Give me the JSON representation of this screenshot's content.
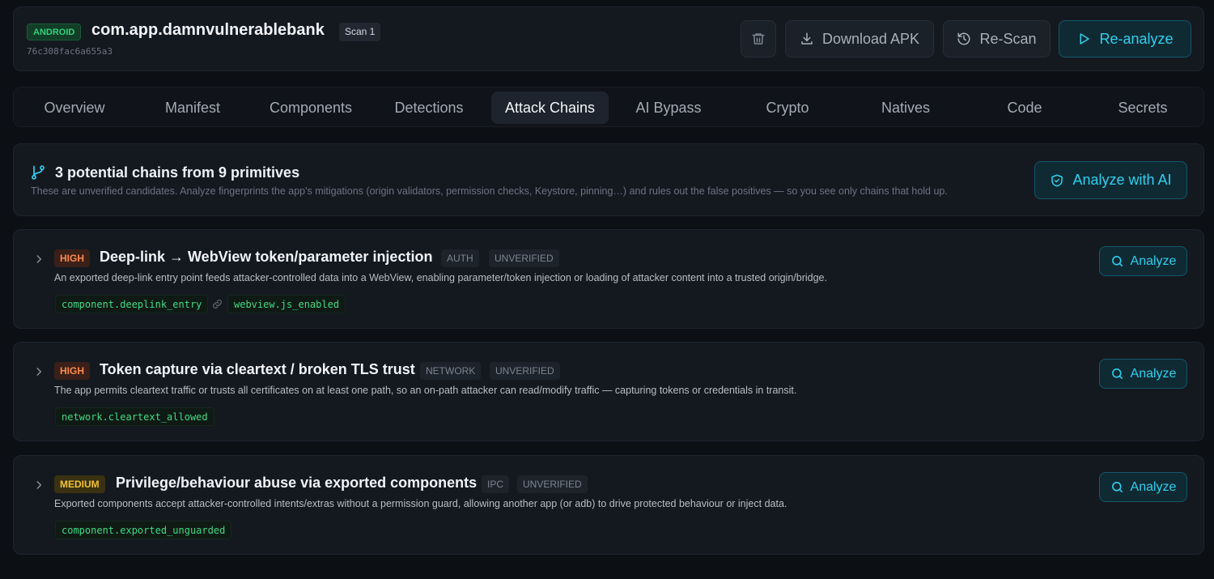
{
  "header": {
    "platform": "ANDROID",
    "package": "com.app.damnvulnerablebank",
    "scan": "Scan 1",
    "hash": "76c308fac6a655a3",
    "download_label": "Download APK",
    "rescan_label": "Re-Scan",
    "reanalyze_label": "Re-analyze",
    "delete_icon": "trash-icon"
  },
  "tabs": [
    "Overview",
    "Manifest",
    "Components",
    "Detections",
    "Attack Chains",
    "AI Bypass",
    "Crypto",
    "Natives",
    "Code",
    "Secrets"
  ],
  "active_tab": "Attack Chains",
  "summary": {
    "title": "3 potential chains from 9 primitives",
    "description": "These are unverified candidates. Analyze fingerprints the app's mitigations (origin validators, permission checks, Keystore, pinning…) and rules out the false positives — so you see only chains that hold up.",
    "analyze_ai_label": "Analyze with AI"
  },
  "chains": [
    {
      "severity": "HIGH",
      "title": "Deep-link → WebView token/parameter injection",
      "category": "AUTH",
      "status": "UNVERIFIED",
      "description": "An exported deep-link entry point feeds attacker-controlled data into a WebView, enabling parameter/token injection or loading of attacker content into a trusted origin/bridge.",
      "primitives": [
        "component.deeplink_entry",
        "webview.js_enabled"
      ],
      "analyze_label": "Analyze"
    },
    {
      "severity": "HIGH",
      "title": "Token capture via cleartext / broken TLS trust",
      "category": "NETWORK",
      "status": "UNVERIFIED",
      "description": "The app permits cleartext traffic or trusts all certificates on at least one path, so an on-path attacker can read/modify traffic — capturing tokens or credentials in transit.",
      "primitives": [
        "network.cleartext_allowed"
      ],
      "analyze_label": "Analyze"
    },
    {
      "severity": "MEDIUM",
      "title": "Privilege/behaviour abuse via exported components",
      "category": "IPC",
      "status": "UNVERIFIED",
      "description": "Exported components accept attacker-controlled intents/extras without a permission guard, allowing another app (or adb) to drive protected behaviour or inject data.",
      "primitives": [
        "component.exported_unguarded"
      ],
      "analyze_label": "Analyze"
    }
  ],
  "colors": {
    "accent": "#2fd0ee",
    "high": "#ff8a4a",
    "medium": "#f2c230",
    "primitive": "#3fdc85",
    "platform": "#34d17a"
  }
}
